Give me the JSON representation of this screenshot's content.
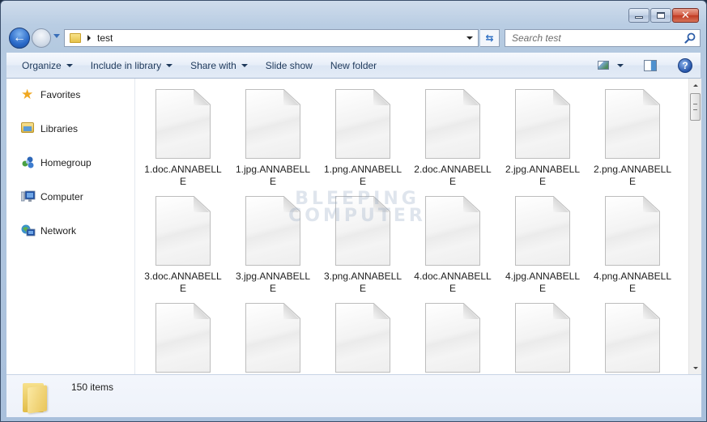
{
  "window": {
    "caption_buttons": [
      "minimize",
      "maximize",
      "close"
    ]
  },
  "navigation": {
    "back_icon": "back-arrow-icon",
    "forward_icon": "forward-arrow-icon",
    "address": {
      "breadcrumb": [
        "test"
      ]
    },
    "search": {
      "placeholder": "Search test"
    }
  },
  "toolbar": {
    "items": [
      {
        "label": "Organize",
        "has_dropdown": true
      },
      {
        "label": "Include in library",
        "has_dropdown": true
      },
      {
        "label": "Share with",
        "has_dropdown": true
      },
      {
        "label": "Slide show",
        "has_dropdown": false
      },
      {
        "label": "New folder",
        "has_dropdown": false
      }
    ],
    "right_icons": [
      "change-view-icon",
      "preview-pane-icon",
      "help-icon"
    ],
    "help_glyph": "?"
  },
  "sidebar": {
    "items": [
      {
        "label": "Favorites",
        "icon": "star-icon"
      },
      {
        "label": "Libraries",
        "icon": "libraries-icon"
      },
      {
        "label": "Homegroup",
        "icon": "homegroup-icon"
      },
      {
        "label": "Computer",
        "icon": "computer-icon"
      },
      {
        "label": "Network",
        "icon": "network-icon"
      }
    ]
  },
  "files": [
    {
      "line1": "1.doc.ANNABELL",
      "line2": "E"
    },
    {
      "line1": "1.jpg.ANNABELL",
      "line2": "E"
    },
    {
      "line1": "1.png.ANNABELL",
      "line2": "E"
    },
    {
      "line1": "2.doc.ANNABELL",
      "line2": "E"
    },
    {
      "line1": "2.jpg.ANNABELL",
      "line2": "E"
    },
    {
      "line1": "2.png.ANNABELL",
      "line2": "E"
    },
    {
      "line1": "3.doc.ANNABELL",
      "line2": "E"
    },
    {
      "line1": "3.jpg.ANNABELL",
      "line2": "E"
    },
    {
      "line1": "3.png.ANNABELL",
      "line2": "E"
    },
    {
      "line1": "4.doc.ANNABELL",
      "line2": "E"
    },
    {
      "line1": "4.jpg.ANNABELL",
      "line2": "E"
    },
    {
      "line1": "4.png.ANNABELL",
      "line2": "E"
    },
    {
      "line1": "",
      "line2": ""
    },
    {
      "line1": "",
      "line2": ""
    },
    {
      "line1": "",
      "line2": ""
    },
    {
      "line1": "",
      "line2": ""
    },
    {
      "line1": "",
      "line2": ""
    },
    {
      "line1": "",
      "line2": ""
    }
  ],
  "watermark": {
    "line1": "BLEEPING",
    "line2": "COMPUTER"
  },
  "details": {
    "item_count": "150 items"
  },
  "scrollbar": {
    "position_fraction": 0.0
  }
}
